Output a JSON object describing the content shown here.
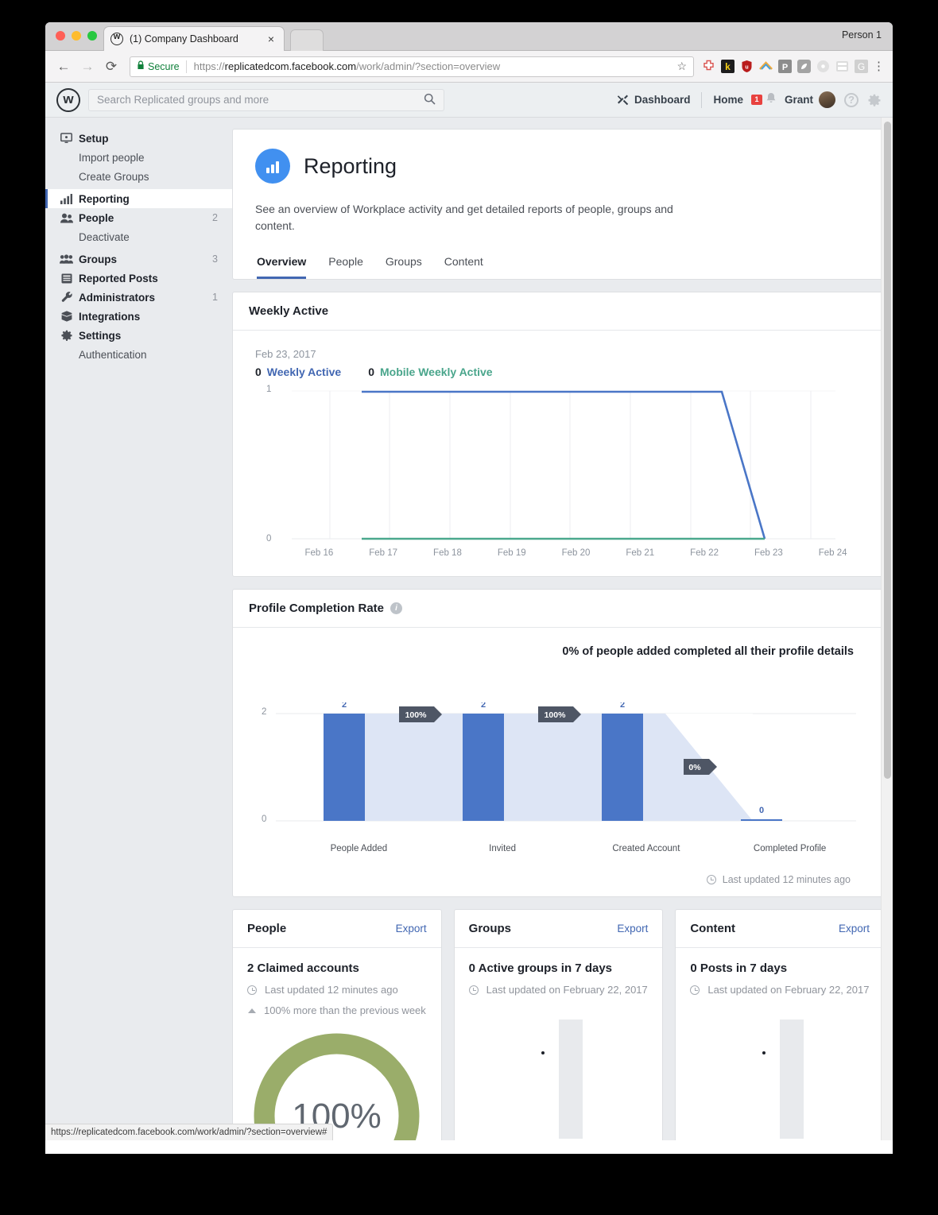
{
  "browser": {
    "tab_title": "(1) Company Dashboard",
    "tab_close": "×",
    "profile_label": "Person 1",
    "back_icon": "←",
    "forward_icon": "→",
    "reload_icon": "⟳",
    "lock_icon": "🔒",
    "secure_label": "Secure",
    "url_scheme": "https://",
    "url_host": "replicatedcom.facebook.com",
    "url_path": "/work/admin/?section=overview",
    "star_icon": "☆",
    "menu_icon": "⋮",
    "status_url": "https://replicatedcom.facebook.com/work/admin/?section=overview#",
    "extensions": [
      {
        "name": "plus-cross-extension",
        "color": "#ffffff"
      },
      {
        "name": "kickstarter-extension",
        "color": "#1d1d1d"
      },
      {
        "name": "shield-extension",
        "color": "#b91c1c"
      },
      {
        "name": "rainbow-arc-extension",
        "color": "#ffffff"
      },
      {
        "name": "pocket-extension",
        "color": "#8c8c8c"
      },
      {
        "name": "leaf-extension",
        "color": "#9a9a9a"
      },
      {
        "name": "record-extension",
        "color": "#d6d6d6"
      },
      {
        "name": "calculator-extension",
        "color": "#d6d6d6"
      },
      {
        "name": "google-extension",
        "color": "#c8c8c8"
      }
    ]
  },
  "workplace_header": {
    "logo": "workplace-logo",
    "search_placeholder": "Search Replicated groups and more",
    "search_value": "",
    "dashboard_label": "Dashboard",
    "home_label": "Home",
    "message_badge": "1",
    "user_name": "Grant",
    "help_icon": "?",
    "settings_icon": "gear"
  },
  "sidebar": {
    "items": [
      {
        "label": "Setup",
        "icon": "monitor-icon",
        "count": "",
        "type": "parent",
        "active": false
      },
      {
        "label": "Import people",
        "icon": "",
        "count": "",
        "type": "sub",
        "active": false
      },
      {
        "label": "Create Groups",
        "icon": "",
        "count": "",
        "type": "sub",
        "active": false
      },
      {
        "label": "Reporting",
        "icon": "bar-chart-icon",
        "count": "",
        "type": "parent",
        "active": true
      },
      {
        "label": "People",
        "icon": "people-icon",
        "count": "2",
        "type": "parent",
        "active": false
      },
      {
        "label": "Deactivate",
        "icon": "",
        "count": "",
        "type": "sub",
        "active": false
      },
      {
        "label": "Groups",
        "icon": "groups-icon",
        "count": "3",
        "type": "parent",
        "active": false
      },
      {
        "label": "Reported Posts",
        "icon": "document-icon",
        "count": "",
        "type": "parent",
        "active": false
      },
      {
        "label": "Administrators",
        "icon": "wrench-icon",
        "count": "1",
        "type": "parent",
        "active": false
      },
      {
        "label": "Integrations",
        "icon": "box-icon",
        "count": "",
        "type": "parent",
        "active": false
      },
      {
        "label": "Settings",
        "icon": "gear-icon",
        "count": "",
        "type": "parent",
        "active": false
      },
      {
        "label": "Authentication",
        "icon": "",
        "count": "",
        "type": "sub",
        "active": false
      }
    ]
  },
  "reporting": {
    "title": "Reporting",
    "description": "See an overview of Workplace activity and get detailed reports of people, groups and content.",
    "tabs": [
      {
        "label": "Overview",
        "selected": true
      },
      {
        "label": "People",
        "selected": false
      },
      {
        "label": "Groups",
        "selected": false
      },
      {
        "label": "Content",
        "selected": false
      }
    ]
  },
  "weekly_active": {
    "card_title": "Weekly Active",
    "date": "Feb 23, 2017",
    "legend": [
      {
        "value": "0",
        "label": "Weekly Active",
        "color": "#4267b2"
      },
      {
        "value": "0",
        "label": "Mobile Weekly Active",
        "color": "#49a58b"
      }
    ]
  },
  "profile_completion": {
    "card_title": "Profile Completion Rate",
    "info_icon": "i",
    "note": "0% of people added completed all their profile details",
    "updated": "Last updated 12 minutes ago"
  },
  "bottom_cards": [
    {
      "title": "People",
      "export_label": "Export",
      "stat": "2 Claimed accounts",
      "updated": "Last updated 12 minutes ago",
      "trend": "100% more than the previous week",
      "donut_label": "100%",
      "donut_color": "#9aad6a",
      "visual": "donut"
    },
    {
      "title": "Groups",
      "export_label": "Export",
      "stat": "0 Active groups in 7 days",
      "updated": "Last updated on February 22, 2017",
      "trend": "",
      "visual": "placeholder-bar"
    },
    {
      "title": "Content",
      "export_label": "Export",
      "stat": "0 Posts in 7 days",
      "updated": "Last updated on February 22, 2017",
      "trend": "",
      "visual": "placeholder-bar"
    }
  ],
  "chart_data": [
    {
      "type": "line",
      "title": "Weekly Active",
      "xlabel": "",
      "ylabel": "",
      "ylim": [
        0,
        1
      ],
      "yticks": [
        "0",
        "1"
      ],
      "x": [
        "Feb 16",
        "Feb 17",
        "Feb 18",
        "Feb 19",
        "Feb 20",
        "Feb 21",
        "Feb 22",
        "Feb 23",
        "Feb 24"
      ],
      "grid": true,
      "series": [
        {
          "name": "Weekly Active",
          "color": "#4a76c7",
          "values": [
            1,
            1,
            1,
            1,
            1,
            1,
            1,
            0,
            null
          ]
        },
        {
          "name": "Mobile Weekly Active",
          "color": "#4aa88d",
          "values": [
            0,
            0,
            0,
            0,
            0,
            0,
            0,
            0,
            null
          ]
        }
      ]
    },
    {
      "type": "bar",
      "title": "Profile Completion Rate",
      "subtitle": "0% of people added completed all their profile details",
      "categories": [
        "People Added",
        "Invited",
        "Created Account",
        "Completed Profile"
      ],
      "values": [
        2,
        2,
        2,
        0
      ],
      "value_labels": [
        "2",
        "2",
        "2",
        "0"
      ],
      "conversion_labels": [
        "100%",
        "100%",
        "0%"
      ],
      "ylim": [
        0,
        2
      ],
      "yticks": [
        "0",
        "2"
      ],
      "bar_color": "#4a76c7",
      "connector_color": "#dde5f5",
      "badge_color": "#4e5665"
    },
    {
      "type": "pie",
      "title": "People claimed accounts",
      "value_label": "100%",
      "values": [
        100,
        0
      ],
      "colors": [
        "#9aad6a",
        "#ffffff"
      ]
    }
  ]
}
